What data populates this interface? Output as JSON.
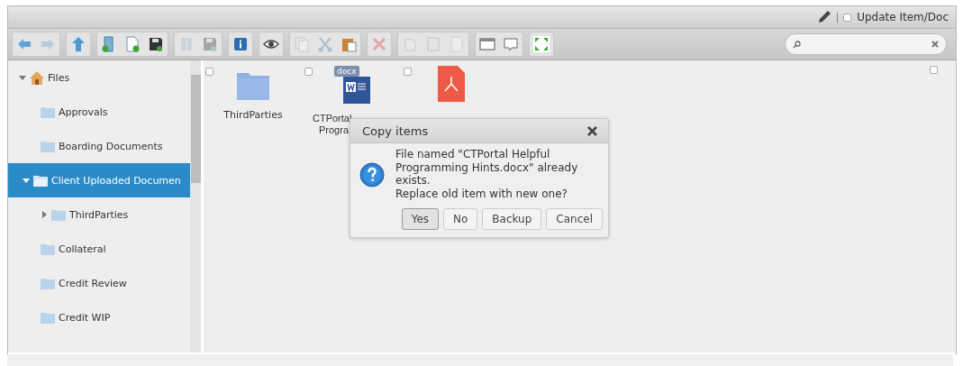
{
  "header": {
    "label": "Update Item/Doc",
    "checked": false
  },
  "toolbar": {
    "groups": [
      [
        {
          "disabled": false
        },
        {
          "disabled": true
        }
      ],
      [
        {
          "disabled": false
        }
      ],
      [
        {
          "disabled": false
        },
        {
          "disabled": false
        },
        {
          "disabled": false
        }
      ],
      [
        {
          "disabled": true
        },
        {
          "disabled": true
        }
      ],
      [
        {
          "disabled": false
        }
      ],
      [
        {
          "disabled": false
        }
      ],
      [
        {
          "disabled": true
        },
        {
          "disabled": true
        },
        {
          "disabled": false
        }
      ],
      [
        {
          "disabled": true
        }
      ],
      [
        {
          "disabled": true
        },
        {
          "disabled": true
        },
        {
          "disabled": true
        }
      ],
      [
        {
          "disabled": false
        },
        {
          "disabled": false
        }
      ],
      [
        {
          "disabled": false
        }
      ]
    ]
  },
  "tree": {
    "label": "Files",
    "expanded": true,
    "selected": false,
    "children": [
      {
        "label": "Approvals",
        "selected": false
      },
      {
        "label": "Boarding Documents",
        "selected": false
      },
      {
        "label": "Client Uploaded Documen",
        "selected": true,
        "expanded": true,
        "children": [
          {
            "label": "ThirdParties",
            "selected": false,
            "expanded": false
          }
        ]
      },
      {
        "label": "Collateral",
        "selected": false
      },
      {
        "label": "Credit Review",
        "selected": false
      },
      {
        "label": "Credit WIP",
        "selected": false
      }
    ]
  },
  "files": [
    {
      "kind": "folder",
      "checked": false,
      "name_lines": [
        "ThirdParties"
      ]
    },
    {
      "kind": "docx",
      "checked": false,
      "badge": "docx",
      "name_lines": [
        "CTPortal",
        "Progra"
      ]
    },
    {
      "kind": "pdf",
      "checked": false
    }
  ],
  "select_all": {
    "checked": false
  },
  "dialog": {
    "title": "Copy items",
    "message": "File named \"CTPortal Helpful Programming Hints.docx\" already exists.",
    "question": "Replace old item with new one?",
    "buttons": [
      {
        "label": "Yes",
        "selected": true
      },
      {
        "label": "No",
        "selected": false
      },
      {
        "label": "Backup",
        "selected": false
      },
      {
        "label": "Cancel",
        "selected": false
      }
    ]
  }
}
